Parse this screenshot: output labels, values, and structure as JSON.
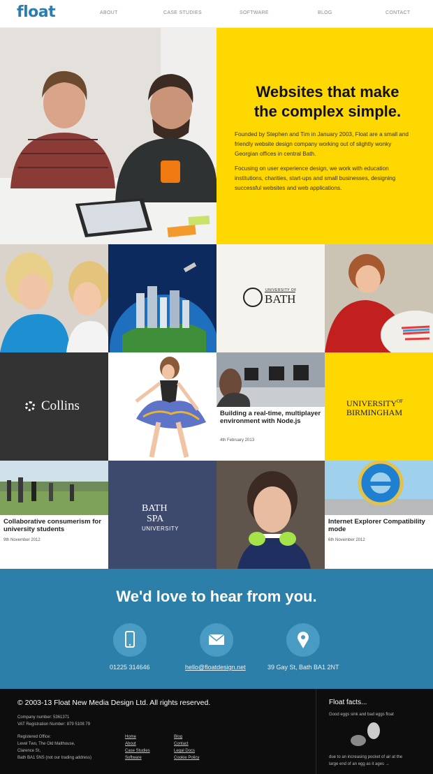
{
  "header": {
    "logo": "float",
    "nav": [
      "ABOUT",
      "CASE STUDIES",
      "SOFTWARE",
      "BLOG",
      "CONTACT"
    ]
  },
  "hero": {
    "title_line1": "Websites that make",
    "title_line2": "the complex simple.",
    "para1": "Founded by Stephen and Tim in January 2003, Float are a small and friendly website design company working out of slightly wonky Georgian offices in central Bath.",
    "para2": "Focusing on user experience design, we work with education institutions, charities, start-ups and small businesses, designing successful websites and web applications."
  },
  "tiles": {
    "bath_logo_small": "UNIVERSITY OF",
    "bath_logo_big": "BATH",
    "collins": "Collins",
    "birmingham_line1": "UNIVERSITY",
    "birmingham_of": "OF",
    "birmingham_line2": "BIRMINGHAM",
    "nodejs_title": "Building a real-time, multiplayer environment with Node.js",
    "nodejs_date": "4th February 2013",
    "consumerism_title": "Collaborative consumerism for university students",
    "consumerism_date": "9th November 2012",
    "bathspa_line1": "BATH",
    "bathspa_line2": "SPA",
    "bathspa_line3": "UNIVERSITY",
    "ie_title": "Internet Explorer Compatibility mode",
    "ie_date": "6th November 2012"
  },
  "contact": {
    "title": "We'd love to hear from you.",
    "phone": "01225 314646",
    "email": "hello@floatdesign.net",
    "address": "39 Gay St, Bath BA1 2NT"
  },
  "footer": {
    "copyright": "© 2003-13 Float New Media Design Ltd. All rights reserved.",
    "company_number": "Company number: 5361371",
    "vat": "VAT Registration Number: 879 5108 79",
    "office_1": "Registered Office:",
    "office_2": "Level Two, The Old Malthouse,",
    "office_3": "Clarence St,",
    "office_4": "Bath BA1 5NS (not our trading address)",
    "links_col1": [
      "Home",
      "About",
      "Case Studies",
      "Software"
    ],
    "links_col2": [
      "Blog",
      "Contact",
      "Legal Docs",
      "Cookie Policy"
    ],
    "facts_title": "Float facts...",
    "facts_sub": "Good eggs sink and bad eggs float",
    "facts_text_1": "due to an increasing pocket of air at the",
    "facts_text_2": "large end of an egg as it ages →"
  },
  "colors": {
    "brand_blue": "#2a7db0",
    "hero_yellow": "#fed800",
    "contact_blue": "#2b7fa9",
    "footer_black": "#0d0d0d"
  },
  "icons": [
    "phone-icon",
    "mail-icon",
    "location-pin-icon"
  ]
}
